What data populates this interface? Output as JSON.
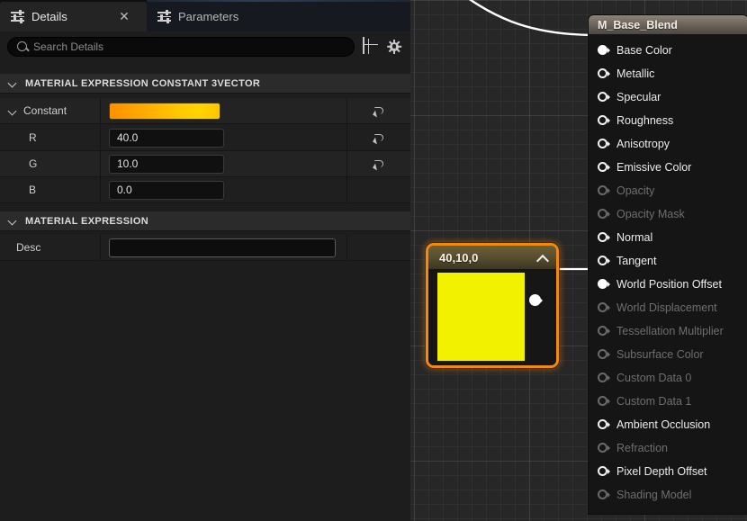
{
  "panel": {
    "tabs": [
      {
        "label": "Details",
        "icon": "sliders-icon",
        "active": true,
        "closable": true
      },
      {
        "label": "Parameters",
        "icon": "sliders-icon",
        "active": false,
        "closable": false
      }
    ],
    "close_label": "✕",
    "search": {
      "placeholder": "Search Details",
      "value": "",
      "icon": "search-icon"
    },
    "toolbar": [
      {
        "name": "column-view-icon",
        "label": ""
      },
      {
        "name": "settings-gear-icon",
        "label": ""
      }
    ],
    "sections": [
      {
        "title": "MATERIAL EXPRESSION CONSTANT 3VECTOR",
        "expanded": true,
        "rows": [
          {
            "name": "Constant",
            "type": "color",
            "value": "",
            "expandable": true,
            "indent": 0,
            "revert": true
          },
          {
            "name": "R",
            "type": "number",
            "value": "40.0",
            "expandable": false,
            "indent": 1,
            "revert": true
          },
          {
            "name": "G",
            "type": "number",
            "value": "10.0",
            "expandable": false,
            "indent": 1,
            "revert": true
          },
          {
            "name": "B",
            "type": "number",
            "value": "0.0",
            "expandable": false,
            "indent": 1,
            "revert": false
          }
        ]
      },
      {
        "title": "MATERIAL EXPRESSION",
        "expanded": true,
        "rows": [
          {
            "name": "Desc",
            "type": "text",
            "value": "",
            "expandable": false,
            "indent": 0,
            "revert": false
          }
        ]
      }
    ]
  },
  "graph": {
    "material_node": {
      "title": "M_Base_Blend",
      "pins": [
        {
          "label": "Base Color",
          "connected": true,
          "disabled": false
        },
        {
          "label": "Metallic",
          "connected": false,
          "disabled": false
        },
        {
          "label": "Specular",
          "connected": false,
          "disabled": false
        },
        {
          "label": "Roughness",
          "connected": false,
          "disabled": false
        },
        {
          "label": "Anisotropy",
          "connected": false,
          "disabled": false
        },
        {
          "label": "Emissive Color",
          "connected": false,
          "disabled": false
        },
        {
          "label": "Opacity",
          "connected": false,
          "disabled": true
        },
        {
          "label": "Opacity Mask",
          "connected": false,
          "disabled": true
        },
        {
          "label": "Normal",
          "connected": false,
          "disabled": false
        },
        {
          "label": "Tangent",
          "connected": false,
          "disabled": false
        },
        {
          "label": "World Position Offset",
          "connected": true,
          "disabled": false
        },
        {
          "label": "World Displacement",
          "connected": false,
          "disabled": true
        },
        {
          "label": "Tessellation Multiplier",
          "connected": false,
          "disabled": true
        },
        {
          "label": "Subsurface Color",
          "connected": false,
          "disabled": true
        },
        {
          "label": "Custom Data 0",
          "connected": false,
          "disabled": true
        },
        {
          "label": "Custom Data 1",
          "connected": false,
          "disabled": true
        },
        {
          "label": "Ambient Occlusion",
          "connected": false,
          "disabled": false
        },
        {
          "label": "Refraction",
          "connected": false,
          "disabled": true
        },
        {
          "label": "Pixel Depth Offset",
          "connected": false,
          "disabled": false
        },
        {
          "label": "Shading Model",
          "connected": false,
          "disabled": true
        }
      ]
    },
    "constant_node": {
      "title": "40,10,0",
      "collapse_icon": "chevron-up-icon",
      "preview_color": "#f2f200",
      "selected": true
    }
  },
  "colors": {
    "selection": "#f08a12",
    "swatch_gradient_start": "#ff9500",
    "swatch_gradient_end": "#ffd200",
    "preview": "#f2f200",
    "wire": "#ffffff",
    "graph_bg": "#272727"
  }
}
